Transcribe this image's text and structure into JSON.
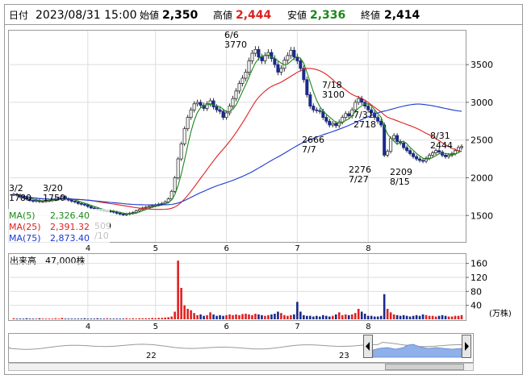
{
  "header": {
    "date_label": "日付",
    "datetime": "2023/08/31 15:00",
    "open_label": "始値",
    "open_value": "2,350",
    "high_label": "高値",
    "high_value": "2,444",
    "low_label": "安値",
    "low_value": "2,336",
    "close_label": "終値",
    "close_value": "2,414"
  },
  "legend": {
    "ma5": "MA(5)",
    "ma5_value": "2,326.40",
    "ma25": "MA(25)",
    "ma25_value": "2,391.32",
    "ma75": "MA(75)",
    "ma75_value": "2,873.40"
  },
  "volume_label": {
    "title": "出来高",
    "value": "47,000株",
    "unit": "(万株)"
  },
  "navigator": {
    "year_22": "22",
    "year_23": "23"
  },
  "colors": {
    "up": "#e02020",
    "down": "#1a2a8a",
    "ma5": "#1a8a1a",
    "ma25": "#e02020",
    "ma75": "#1a3ad0",
    "high": "#e02020",
    "low": "#1a8a1a",
    "frame": "#999999",
    "nav_fill": "#8fb0e8"
  },
  "chart_data": [
    {
      "type": "candlestick",
      "period": "daily",
      "price_axis": {
        "ylim": [
          1150,
          3950
        ],
        "ticks": [
          1500,
          2000,
          2500,
          3000,
          3500
        ]
      },
      "month_labels": [
        "4",
        "5",
        "6",
        "7",
        "8"
      ],
      "annotations": [
        {
          "date": "3/2",
          "price": "1780"
        },
        {
          "date": "3/20",
          "price": "1750"
        },
        {
          "date": "6/6",
          "price": "3770"
        },
        {
          "date": "7/18",
          "price": "3100"
        },
        {
          "date": "7/31",
          "price": "2718"
        },
        {
          "date": "7/7",
          "price": "2666"
        },
        {
          "date": "7/27",
          "price": "2276"
        },
        {
          "date": "8/15",
          "price": "2209"
        },
        {
          "date": "8/31",
          "price": "2444"
        },
        {
          "date": "/10",
          "price": "509"
        }
      ],
      "close": [
        1780,
        1770,
        1745,
        1735,
        1720,
        1700,
        1690,
        1700,
        1685,
        1690,
        1695,
        1700,
        1710,
        1720,
        1730,
        1750,
        1720,
        1705,
        1690,
        1680,
        1660,
        1650,
        1640,
        1620,
        1600,
        1590,
        1580,
        1570,
        1560,
        1560,
        1555,
        1545,
        1530,
        1520,
        1510,
        1520,
        1530,
        1540,
        1560,
        1580,
        1600,
        1610,
        1620,
        1630,
        1640,
        1650,
        1660,
        1680,
        1720,
        1820,
        2000,
        2250,
        2450,
        2650,
        2800,
        2900,
        2980,
        3000,
        2960,
        2920,
        2980,
        3020,
        2940,
        2900,
        2880,
        2800,
        2860,
        2950,
        3050,
        3150,
        3250,
        3320,
        3400,
        3550,
        3650,
        3700,
        3600,
        3550,
        3620,
        3660,
        3580,
        3500,
        3400,
        3450,
        3560,
        3620,
        3690,
        3600,
        3550,
        3450,
        3300,
        3100,
        2950,
        2900,
        2890,
        2880,
        2800,
        2750,
        2700,
        2720,
        2690,
        2740,
        2800,
        2850,
        2820,
        2900,
        3000,
        3050,
        3000,
        2950,
        2900,
        2860,
        2800,
        2750,
        2700,
        2300,
        2350,
        2520,
        2560,
        2480,
        2460,
        2400,
        2360,
        2320,
        2280,
        2250,
        2230,
        2220,
        2260,
        2300,
        2330,
        2360,
        2340,
        2300,
        2280,
        2300,
        2320,
        2360,
        2400,
        2414
      ],
      "open_close_note": "daily candles, MA(5), MA(25), MA(75) overlays"
    },
    {
      "type": "bar",
      "title": "出来高",
      "yticks": [
        40,
        80,
        120,
        160
      ],
      "ylim": [
        0,
        180
      ],
      "month_labels": [
        "4",
        "5",
        "6",
        "7",
        "8"
      ],
      "values": [
        3,
        2,
        2,
        2,
        3,
        2,
        2,
        2,
        3,
        2,
        2,
        2,
        2,
        3,
        2,
        4,
        2,
        2,
        2,
        2,
        2,
        2,
        3,
        2,
        2,
        2,
        3,
        2,
        2,
        3,
        2,
        2,
        2,
        2,
        2,
        3,
        2,
        3,
        2,
        3,
        3,
        3,
        3,
        4,
        3,
        4,
        4,
        5,
        6,
        8,
        22,
        168,
        90,
        40,
        30,
        26,
        18,
        12,
        14,
        10,
        12,
        20,
        14,
        10,
        12,
        10,
        12,
        14,
        12,
        14,
        12,
        15,
        16,
        14,
        12,
        16,
        14,
        12,
        10,
        12,
        14,
        16,
        22,
        18,
        12,
        10,
        12,
        14,
        50,
        22,
        12,
        10,
        10,
        8,
        10,
        8,
        12,
        10,
        8,
        10,
        14,
        20,
        12,
        14,
        12,
        14,
        18,
        30,
        22,
        16,
        10,
        10,
        8,
        8,
        10,
        72,
        30,
        20,
        14,
        12,
        10,
        12,
        10,
        8,
        10,
        12,
        10,
        14,
        12,
        10,
        10,
        8,
        10,
        12,
        10,
        8,
        8,
        10,
        10,
        12
      ]
    }
  ]
}
